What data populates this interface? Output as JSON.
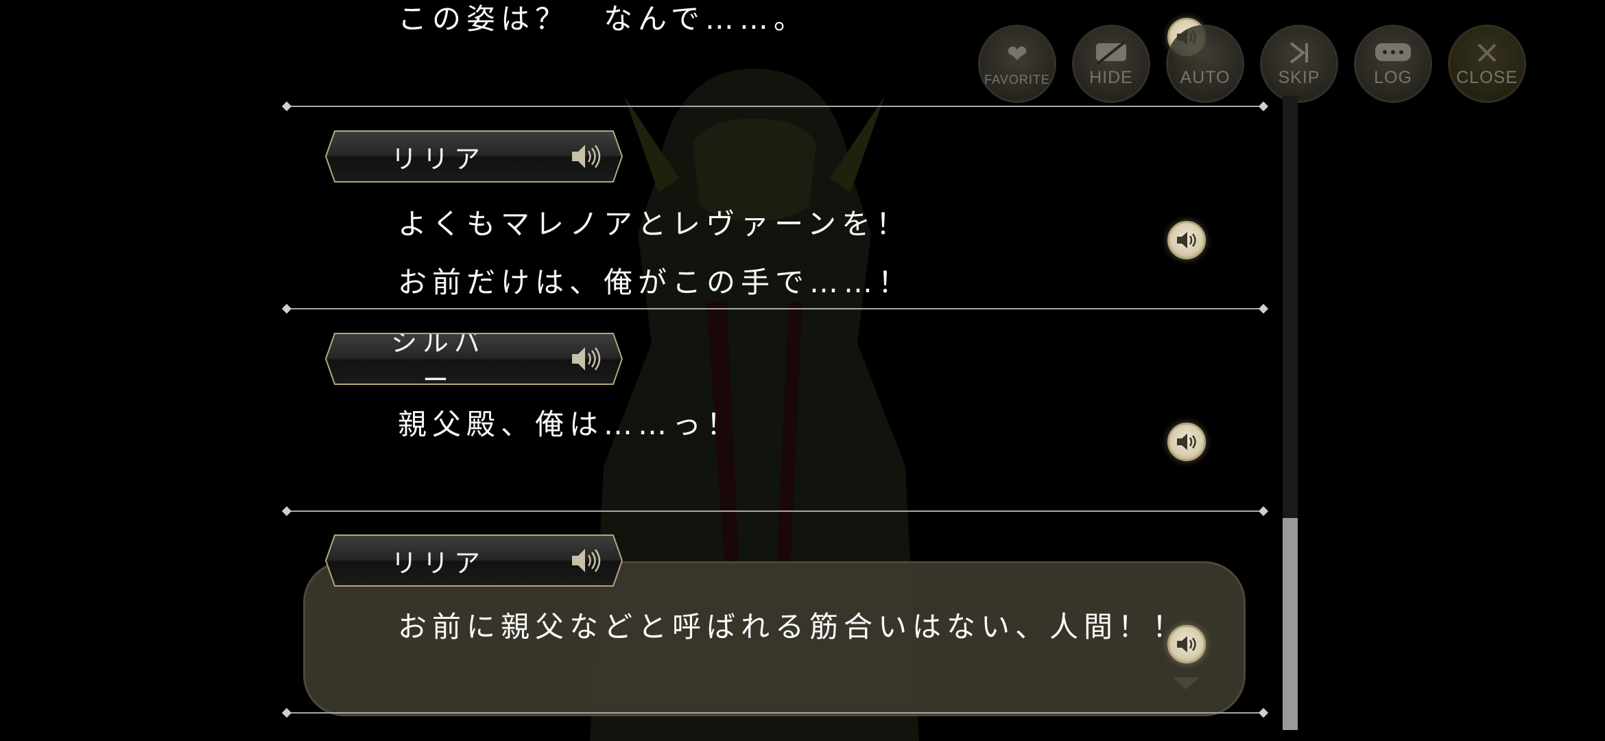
{
  "menu": [
    {
      "id": "favorite",
      "label": "FAVORITE",
      "icon": "heart-icon"
    },
    {
      "id": "hide",
      "label": "HIDE",
      "icon": "hide-icon"
    },
    {
      "id": "auto",
      "label": "AUTO",
      "icon": "auto-icon"
    },
    {
      "id": "skip",
      "label": "SKIP",
      "icon": "skip-icon"
    },
    {
      "id": "log",
      "label": "LOG",
      "icon": "chat-bubble-icon"
    },
    {
      "id": "close",
      "label": "CLOSE",
      "icon": "close-icon"
    }
  ],
  "log": {
    "top_partial_line": "この姿は？　なんで……。",
    "entries": [
      {
        "speaker": "リリア",
        "lines": [
          "よくもマレノアとレヴァーンを！",
          "お前だけは、俺がこの手で……！"
        ]
      },
      {
        "speaker": "シルバー",
        "lines": [
          "親父殿、俺は……っ！"
        ]
      },
      {
        "speaker": "リリア",
        "lines": [
          "お前に親父などと呼ばれる筋合いはない、人間！！"
        ]
      }
    ]
  },
  "colors": {
    "accent_gold": "#c8b68a",
    "textbox_bg": "#3c3a2e",
    "background": "#000000"
  }
}
